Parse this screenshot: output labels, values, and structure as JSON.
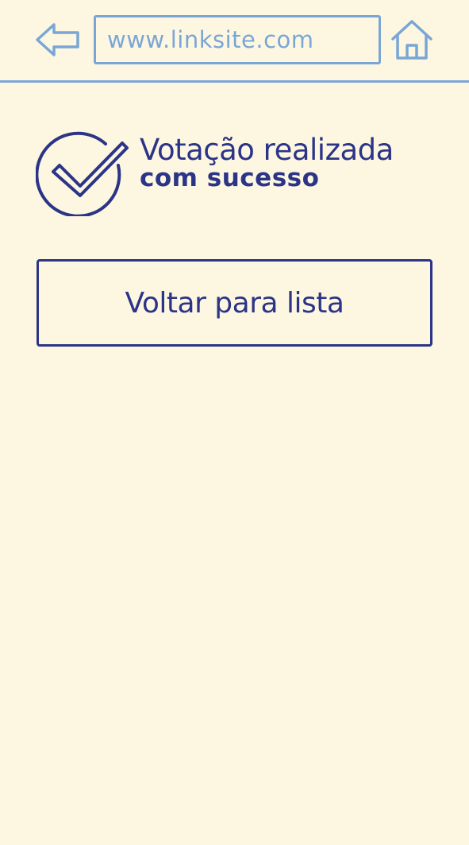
{
  "browser": {
    "url_value": "",
    "url_placeholder": "www.linksite.com",
    "back_icon": "back-arrow-icon",
    "home_icon": "home-icon"
  },
  "status": {
    "title_line1": "Votação realizada",
    "title_line2": "com sucesso",
    "icon": "check-circle-icon"
  },
  "actions": {
    "back_to_list_label": "Voltar para lista"
  },
  "colors": {
    "background": "#fdf7e1",
    "browser_accent": "#7aa6d6",
    "primary": "#2b3487"
  }
}
